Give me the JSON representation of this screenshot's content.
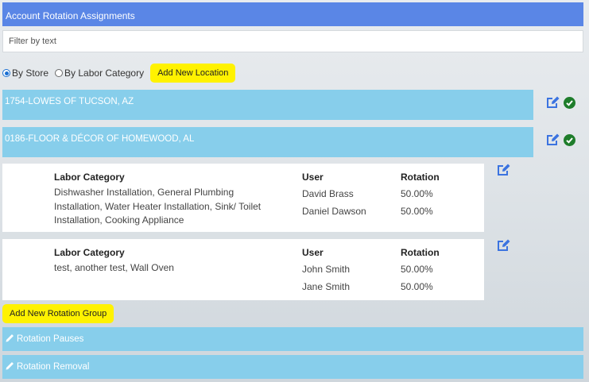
{
  "header": {
    "title": "Account Rotation Assignments"
  },
  "filter": {
    "placeholder": "Filter by text"
  },
  "view_options": {
    "by_store": "By Store",
    "by_labor_category": "By Labor Category",
    "selected": "By Store"
  },
  "add_location_label": "Add New Location",
  "stores": [
    {
      "name": "1754-LOWES OF TUCSON, AZ"
    },
    {
      "name": "0186-FLOOR & DÉCOR OF HOMEWOOD, AL"
    }
  ],
  "column_headers": {
    "labor_category": "Labor Category",
    "user": "User",
    "rotation": "Rotation"
  },
  "rotation_groups": [
    {
      "labor_category": "Dishwasher Installation, General Plumbing Installation, Water Heater Installation, Sink/ Toilet Installation, Cooking Appliance",
      "users": [
        {
          "name": "David Brass",
          "rotation": "50.00%"
        },
        {
          "name": "Daniel Dawson",
          "rotation": "50.00%"
        }
      ]
    },
    {
      "labor_category": "test, another test, Wall Oven",
      "users": [
        {
          "name": "John Smith",
          "rotation": "50.00%"
        },
        {
          "name": "Jane Smith",
          "rotation": "50.00%"
        }
      ]
    }
  ],
  "add_rotation_group_label": "Add New Rotation Group",
  "sections": [
    {
      "label": "Rotation Pauses"
    },
    {
      "label": "Rotation Removal"
    }
  ],
  "colors": {
    "header": "#5a86e6",
    "store_bar": "#87ceeb",
    "button": "#fff200",
    "edit_icon": "#3b73e0",
    "check_icon": "#1e7d2b"
  }
}
